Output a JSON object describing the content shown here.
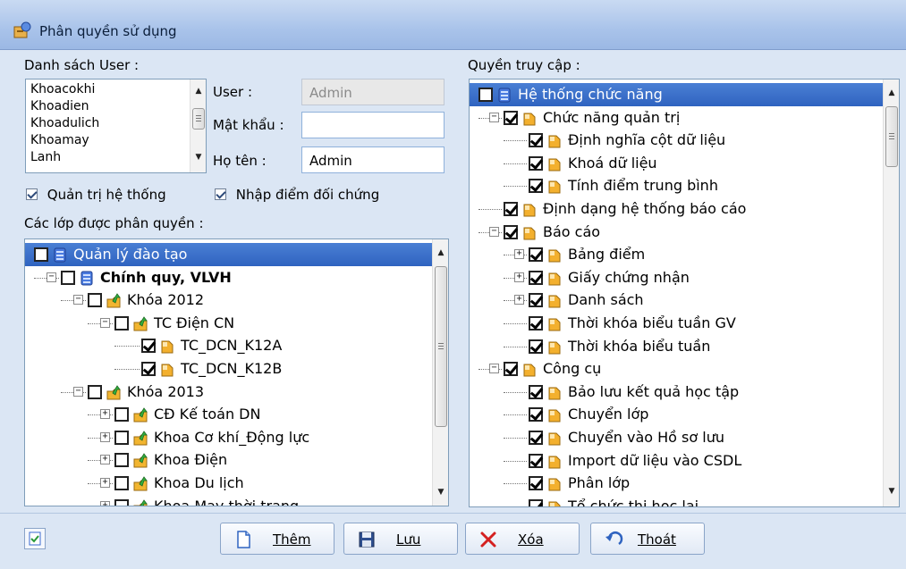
{
  "window": {
    "title": "Phân quyền sử dụng"
  },
  "users": {
    "label": "Danh sách User :",
    "items": [
      "Khoacokhi",
      "Khoadien",
      "Khoadulich",
      "Khoamay",
      "Lanh"
    ]
  },
  "fields": {
    "user_label": "User :",
    "user_value": "Admin",
    "password_label": "Mật khẩu :",
    "password_value": "",
    "fullname_label": "Họ tên :",
    "fullname_value": "Admin"
  },
  "options": {
    "admin_label": "Quản trị hệ thống",
    "admin_checked": true,
    "control_label": "Nhập điểm đối chứng",
    "control_checked": true
  },
  "classes": {
    "label": "Các lớp được phân quyền :",
    "rows": [
      {
        "text": "Quản lý đào tạo",
        "level": 0,
        "checked": false,
        "icon": "database-icon",
        "selected": true,
        "expander": ""
      },
      {
        "text": "Chính quy, VLVH",
        "level": 1,
        "checked": false,
        "icon": "database-icon",
        "bold": true,
        "expander": "-"
      },
      {
        "text": "Khóa 2012",
        "level": 2,
        "checked": false,
        "icon": "folder-arrow-icon",
        "expander": "-"
      },
      {
        "text": "TC Điện CN",
        "level": 3,
        "checked": false,
        "icon": "folder-arrow-icon",
        "expander": "-"
      },
      {
        "text": "TC_DCN_K12A",
        "level": 4,
        "checked": true,
        "icon": "doc-icon",
        "expander": ""
      },
      {
        "text": "TC_DCN_K12B",
        "level": 4,
        "checked": true,
        "icon": "doc-icon",
        "expander": ""
      },
      {
        "text": "Khóa 2013",
        "level": 2,
        "checked": false,
        "icon": "folder-arrow-icon",
        "expander": "-"
      },
      {
        "text": "CĐ Kế toán DN",
        "level": 3,
        "checked": false,
        "icon": "folder-arrow-icon",
        "expander": "+"
      },
      {
        "text": "Khoa Cơ khí_Động lực",
        "level": 3,
        "checked": false,
        "icon": "folder-arrow-icon",
        "expander": "+"
      },
      {
        "text": "Khoa Điện",
        "level": 3,
        "checked": false,
        "icon": "folder-arrow-icon",
        "expander": "+"
      },
      {
        "text": "Khoa Du lịch",
        "level": 3,
        "checked": false,
        "icon": "folder-arrow-icon",
        "expander": "+"
      },
      {
        "text": "Khoa May thời trang",
        "level": 3,
        "checked": false,
        "icon": "folder-arrow-icon",
        "expander": "+"
      }
    ]
  },
  "access": {
    "label": "Quyền truy cập :",
    "rows": [
      {
        "text": "Hệ thống chức năng",
        "level": 0,
        "checked": false,
        "icon": "database-icon",
        "selected": true,
        "expander": ""
      },
      {
        "text": "Chức năng quản trị",
        "level": 1,
        "checked": true,
        "icon": "doc-icon",
        "expander": "-"
      },
      {
        "text": "Định nghĩa cột dữ liệu",
        "level": 2,
        "checked": true,
        "icon": "doc-icon",
        "expander": ""
      },
      {
        "text": "Khoá dữ liệu",
        "level": 2,
        "checked": true,
        "icon": "doc-icon",
        "expander": ""
      },
      {
        "text": "Tính điểm trung bình",
        "level": 2,
        "checked": true,
        "icon": "doc-icon",
        "expander": ""
      },
      {
        "text": "Định dạng hệ thống báo cáo",
        "level": 1,
        "checked": true,
        "icon": "doc-icon",
        "expander": ""
      },
      {
        "text": "Báo cáo",
        "level": 1,
        "checked": true,
        "icon": "doc-icon",
        "expander": "-"
      },
      {
        "text": "Bảng điểm",
        "level": 2,
        "checked": true,
        "icon": "doc-icon",
        "expander": "+"
      },
      {
        "text": "Giấy chứng nhận",
        "level": 2,
        "checked": true,
        "icon": "doc-icon",
        "expander": "+"
      },
      {
        "text": "Danh sách",
        "level": 2,
        "checked": true,
        "icon": "doc-icon",
        "expander": "+"
      },
      {
        "text": "Thời khóa biểu tuần GV",
        "level": 2,
        "checked": true,
        "icon": "doc-icon",
        "expander": ""
      },
      {
        "text": "Thời khóa biểu tuần",
        "level": 2,
        "checked": true,
        "icon": "doc-icon",
        "expander": ""
      },
      {
        "text": "Công cụ",
        "level": 1,
        "checked": true,
        "icon": "doc-icon",
        "expander": "-"
      },
      {
        "text": "Bảo lưu kết quả học tập",
        "level": 2,
        "checked": true,
        "icon": "doc-icon",
        "expander": ""
      },
      {
        "text": "Chuyển lớp",
        "level": 2,
        "checked": true,
        "icon": "doc-icon",
        "expander": ""
      },
      {
        "text": "Chuyển vào Hồ sơ lưu",
        "level": 2,
        "checked": true,
        "icon": "doc-icon",
        "expander": ""
      },
      {
        "text": "Import dữ liệu vào CSDL",
        "level": 2,
        "checked": true,
        "icon": "doc-icon",
        "expander": ""
      },
      {
        "text": "Phân lớp",
        "level": 2,
        "checked": true,
        "icon": "doc-icon",
        "expander": ""
      },
      {
        "text": "Tổ chức thi học lại",
        "level": 2,
        "checked": true,
        "icon": "doc-icon",
        "expander": ""
      }
    ]
  },
  "buttons": {
    "add": "Thêm",
    "save": "Lưu",
    "delete": "Xóa",
    "exit": "Thoát"
  },
  "colors": {
    "accent": "#2f63c0",
    "folder": "#f0a020",
    "db": "#3a6ad0"
  }
}
